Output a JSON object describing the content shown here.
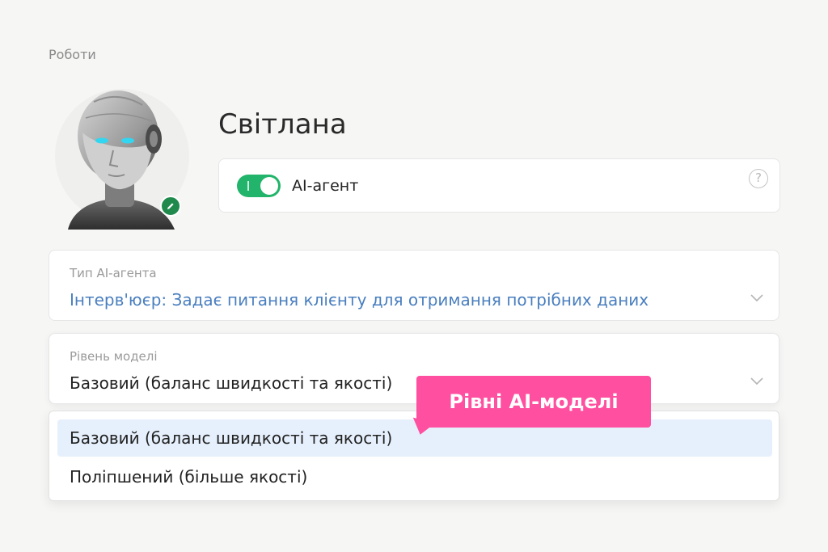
{
  "breadcrumb": "Роботи",
  "profile": {
    "name": "Світлана",
    "avatar_icon": "robot-avatar-icon",
    "edit_icon": "pencil-icon"
  },
  "agent_toggle": {
    "label": "AI-агент",
    "enabled": true,
    "help_icon": "question-circle-icon",
    "help_glyph": "?"
  },
  "agent_type": {
    "label": "Тип AI-агента",
    "value": "Інтерв'юєр: Задає питання клієнту для отримання потрібних даних"
  },
  "model_level": {
    "label": "Рівень моделі",
    "value": "Базовий (баланс швидкості та якості)",
    "options": [
      {
        "label": "Базовий (баланс швидкості та якості)",
        "selected": true
      },
      {
        "label": "Поліпшений (більше якості)",
        "selected": false
      }
    ]
  },
  "callout": {
    "text": "Рівні AI-моделі"
  },
  "colors": {
    "accent_green": "#22b46a",
    "link_blue": "#4a7fbf",
    "callout_pink": "#ff4fa0",
    "selected_bg": "#e6f0fc"
  }
}
